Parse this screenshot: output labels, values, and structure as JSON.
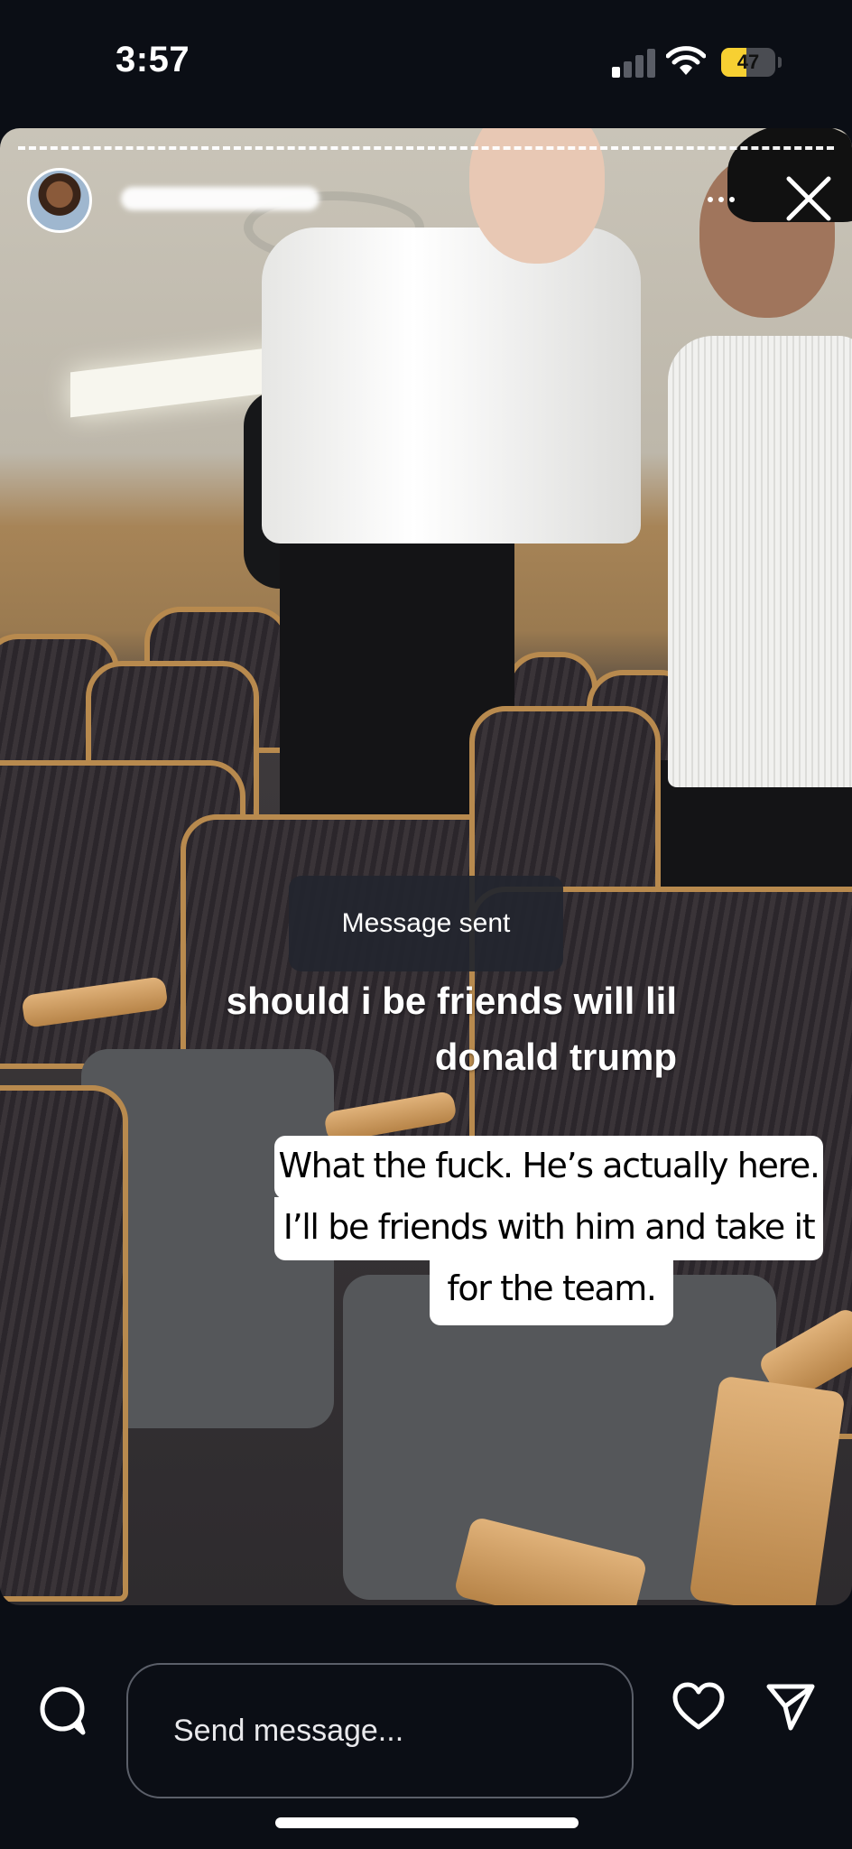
{
  "status_bar": {
    "time": "3:57",
    "battery_percent": "47",
    "battery_level": 0.47,
    "signal_bars_active": 1,
    "signal_bars_total": 4
  },
  "story": {
    "progress_segments": 1,
    "toast": "Message sent",
    "caption": "should i be friends will lil donald trump",
    "reply_lines": [
      "What the fuck. He’s actually here.",
      "I’ll be friends with him and take it",
      "for the team."
    ]
  },
  "composer": {
    "placeholder": "Send message..."
  },
  "icons": {
    "camera": "camera-icon",
    "more": "more-icon",
    "close": "close-icon",
    "like": "heart-icon",
    "share": "send-icon",
    "wifi": "wifi-icon",
    "signal": "signal-icon",
    "battery": "battery-icon"
  },
  "colors": {
    "background": "#0b0e15",
    "battery_fill": "#f7d032",
    "toast_bg": "#22262e",
    "input_border": "#5b5f69"
  }
}
